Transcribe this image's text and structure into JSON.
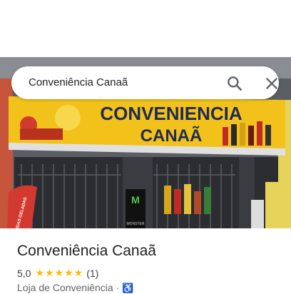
{
  "search": {
    "query": "Conveniência Canaã"
  },
  "storefront": {
    "sign_line1": "CONVENIENCIA",
    "sign_line2": "CANAÃ",
    "banner_text": "BEBIDAS GELADAS",
    "cooler_brand": "MONSTER"
  },
  "place": {
    "name": "Conveniência Canaã",
    "rating": "5,0",
    "stars": "★★★★★",
    "review_count": "(1)",
    "category": "Loja de Conveniência ·",
    "accessibility_icon": "wheelchair-icon"
  },
  "colors": {
    "star": "#fbbc04",
    "sign_yellow": "#f2c21b",
    "sign_text": "#1f2a55",
    "accent_blue": "#1a73e8"
  }
}
